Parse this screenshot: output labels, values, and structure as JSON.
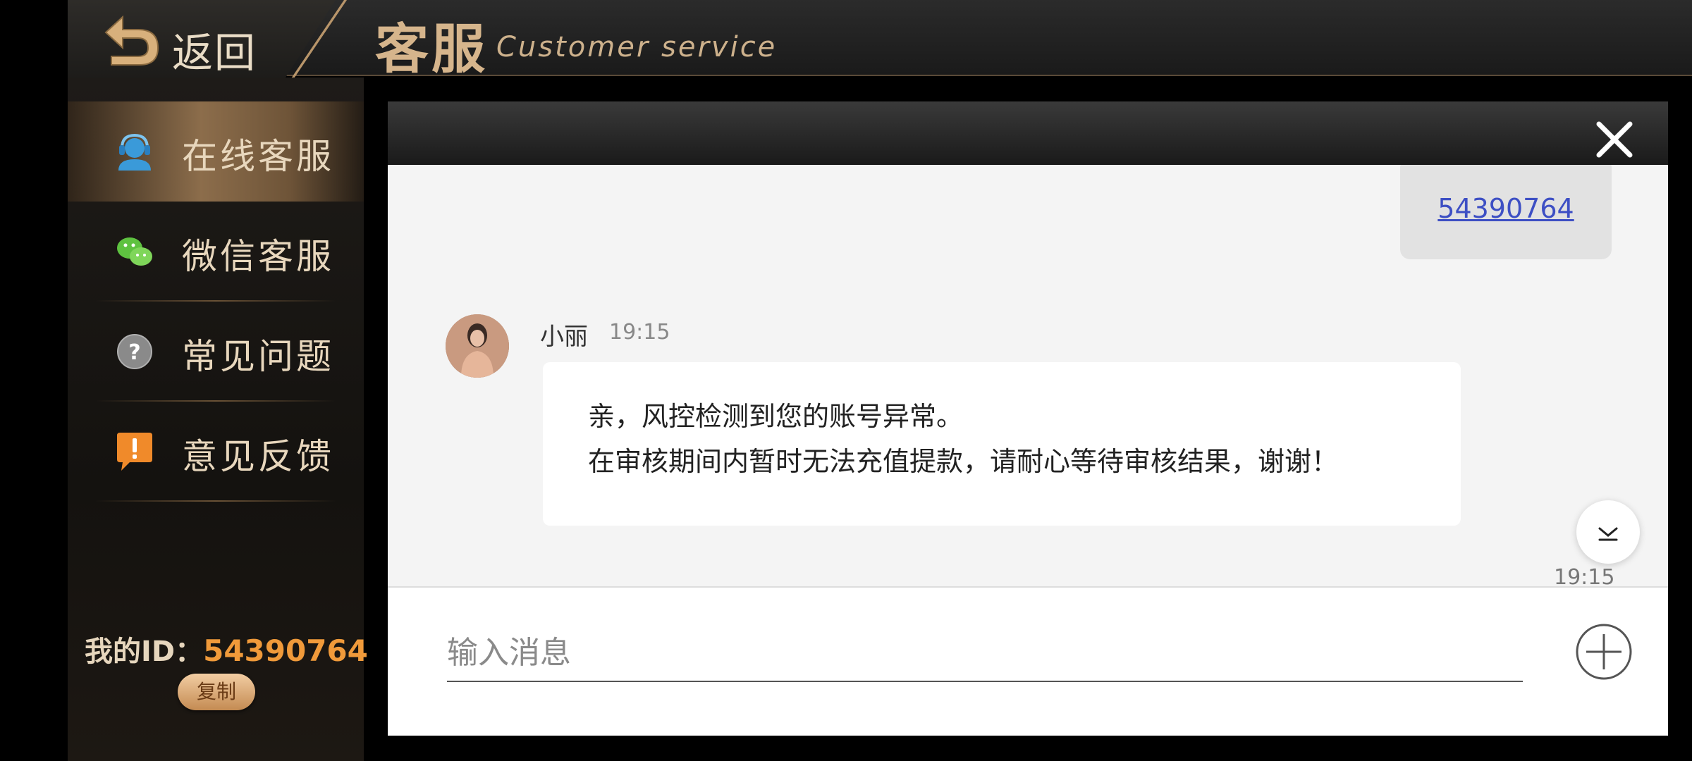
{
  "header": {
    "back_label": "返回",
    "title": "客服",
    "subtitle": "Customer service"
  },
  "sidebar": {
    "items": [
      {
        "label": "在线客服",
        "icon": "headset-icon",
        "active": true
      },
      {
        "label": "微信客服",
        "icon": "wechat-icon",
        "active": false
      },
      {
        "label": "常见问题",
        "icon": "question-icon",
        "active": false
      },
      {
        "label": "意见反馈",
        "icon": "feedback-icon",
        "active": false
      }
    ],
    "id_label": "我的ID：",
    "id_value": "54390764",
    "copy_label": "复制"
  },
  "chat": {
    "my_message": "54390764",
    "agent_name": "小丽",
    "agent_time": "19:15",
    "agent_message_line1": "亲，风控检测到您的账号异常。",
    "agent_message_line2": "在审核期间内暂时无法充值提款，请耐心等待审核结果，谢谢！",
    "bottom_time": "19:15",
    "input_placeholder": "输入消息"
  },
  "colors": {
    "accent_gold": "#d6b58c",
    "id_orange": "#f09a3a",
    "link_blue": "#3d4fc4"
  }
}
